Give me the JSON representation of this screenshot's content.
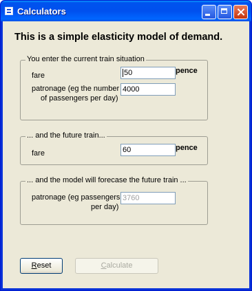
{
  "window": {
    "title": "Calculators"
  },
  "heading": "This is a simple elasticity model of demand.",
  "current": {
    "legend": "You enter the current train situation",
    "fare_label": "fare",
    "fare_value": "50",
    "fare_unit": "pence",
    "patronage_label_1": "patronage (eg the number",
    "patronage_label_2": "of passengers per day)",
    "patronage_value": "4000"
  },
  "future": {
    "legend": "... and the future train...",
    "fare_label": "fare",
    "fare_value": "60",
    "fare_unit": "pence"
  },
  "forecast": {
    "legend": "... and the model will forecase the future train ...",
    "patronage_label_1": "patronage (eg passengers",
    "patronage_label_2": "per day)",
    "patronage_value": "3760"
  },
  "buttons": {
    "reset_mnemonic": "R",
    "reset_rest": "eset",
    "calculate_mnemonic": "C",
    "calculate_rest": "alculate"
  }
}
